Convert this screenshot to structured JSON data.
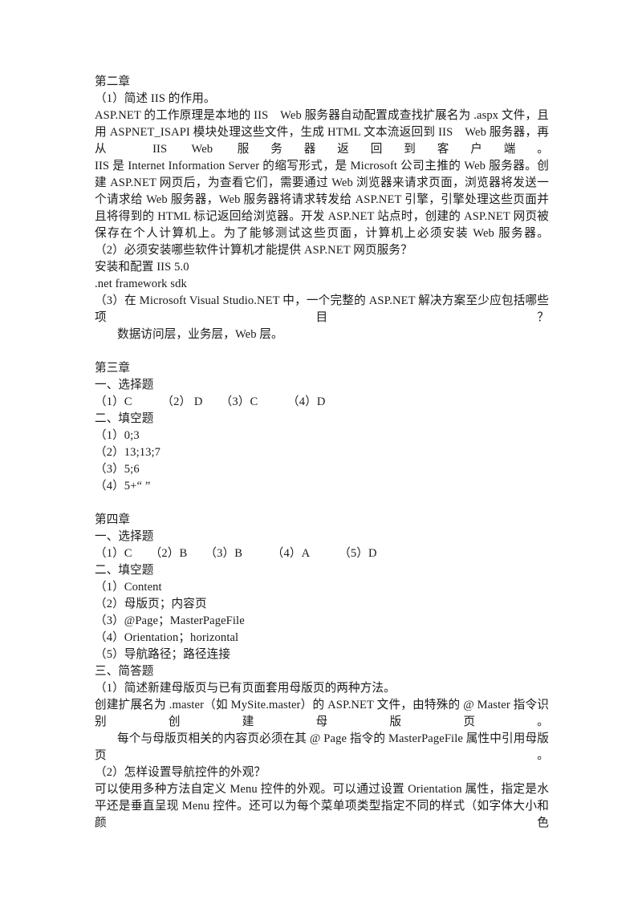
{
  "document": {
    "page_background": "#ffffff",
    "text_color": "#1a1a1a",
    "script": "Simplified Chinese with Latin technical terms"
  },
  "blocks": [
    {
      "id": "chapter2-heading",
      "name": "chapter-2-heading",
      "text": "第二章"
    },
    {
      "id": "ch2-q1",
      "name": "chapter-2-question-1",
      "text": "（1）简述 IIS 的作用。"
    },
    {
      "id": "ch2-a1-p1",
      "name": "chapter-2-answer-1-paragraph-1",
      "text": "ASP.NET 的工作原理是本地的 IIS　Web 服务器自动配置成查找扩展名为 .aspx 文件，且用 ASPNET_ISAPI 模块处理这些文件，生成 HTML 文本流返回到 IIS　Web 服务器，再从 IIS Web 服务器返回到客户端。"
    },
    {
      "id": "ch2-a1-p2",
      "name": "chapter-2-answer-1-paragraph-2",
      "text": "IIS 是 Internet Information Server 的缩写形式，是 Microsoft 公司主推的 Web 服务器。创建 ASP.NET 网页后，为查看它们，需要通过 Web 浏览器来请求页面，浏览器将发送一个请求给 Web 服务器，Web 服务器将请求转发给 ASP.NET 引擎，引擎处理这些页面并且将得到的 HTML 标记返回给浏览器。开发 ASP.NET 站点时，创建的 ASP.NET 网页被保存在个人计算机上。为了能够测试这些页面，计算机上必须安装 Web 服务器。"
    },
    {
      "id": "ch2-q2",
      "name": "chapter-2-question-2",
      "text": "（2）必须安装哪些软件计算机才能提供 ASP.NET 网页服务？"
    },
    {
      "id": "ch2-a2-l1",
      "name": "chapter-2-answer-2-line-1",
      "text": "安装和配置 IIS 5.0"
    },
    {
      "id": "ch2-a2-l2",
      "name": "chapter-2-answer-2-line-2",
      "text": ".net framework sdk"
    },
    {
      "id": "ch2-q3",
      "name": "chapter-2-question-3",
      "text": "（3）在 Microsoft Visual Studio.NET 中，一个完整的 ASP.NET 解决方案至少应包括哪些项目？"
    },
    {
      "id": "ch2-a3",
      "name": "chapter-2-answer-3",
      "text": "数据访问层，业务层，Web 层。"
    },
    {
      "id": "chapter3-heading",
      "name": "chapter-3-heading",
      "text": "第三章"
    },
    {
      "id": "ch3-sec1",
      "name": "chapter-3-section-1-heading",
      "text": "一、选择题"
    },
    {
      "id": "ch3-mcq",
      "name": "chapter-3-multiple-choice-answers",
      "text": "（1）C　　　（2） D　　（3）C　　　（4）D"
    },
    {
      "id": "ch3-sec2",
      "name": "chapter-3-section-2-heading",
      "text": "二、填空题"
    },
    {
      "id": "ch3-fill-1",
      "name": "chapter-3-fill-blank-1",
      "text": "（1）0;3"
    },
    {
      "id": "ch3-fill-2",
      "name": "chapter-3-fill-blank-2",
      "text": "（2）13;13;7"
    },
    {
      "id": "ch3-fill-3",
      "name": "chapter-3-fill-blank-3",
      "text": "（3）5;6"
    },
    {
      "id": "ch3-fill-4",
      "name": "chapter-3-fill-blank-4",
      "text": "（4）5+“ ”"
    },
    {
      "id": "chapter4-heading",
      "name": "chapter-4-heading",
      "text": "第四章"
    },
    {
      "id": "ch4-sec1",
      "name": "chapter-4-section-1-heading",
      "text": "一、选择题"
    },
    {
      "id": "ch4-mcq",
      "name": "chapter-4-multiple-choice-answers",
      "text": "（1）C　　（2）B　　（3）B　　　（4）A　　　（5）D"
    },
    {
      "id": "ch4-sec2",
      "name": "chapter-4-section-2-heading",
      "text": "二、填空题"
    },
    {
      "id": "ch4-fill-1",
      "name": "chapter-4-fill-blank-1",
      "text": "（1）Content"
    },
    {
      "id": "ch4-fill-2",
      "name": "chapter-4-fill-blank-2",
      "text": "（2）母版页；内容页"
    },
    {
      "id": "ch4-fill-3",
      "name": "chapter-4-fill-blank-3",
      "text": "（3）@Page；MasterPageFile"
    },
    {
      "id": "ch4-fill-4",
      "name": "chapter-4-fill-blank-4",
      "text": "（4）Orientation；horizontal"
    },
    {
      "id": "ch4-fill-5",
      "name": "chapter-4-fill-blank-5",
      "text": "（5）导航路径；路径连接"
    },
    {
      "id": "ch4-sec3",
      "name": "chapter-4-section-3-heading",
      "text": "三、简答题"
    },
    {
      "id": "ch4-q1",
      "name": "chapter-4-question-1",
      "text": "（1）简述新建母版页与已有页面套用母版页的两种方法。"
    },
    {
      "id": "ch4-a1-p1",
      "name": "chapter-4-answer-1-paragraph-1",
      "text": "创建扩展名为 .master（如 MySite.master）的 ASP.NET 文件，由特殊的 @ Master 指令识别创建母版页。"
    },
    {
      "id": "ch4-a1-p2",
      "name": "chapter-4-answer-1-paragraph-2",
      "text": "每个与母版页相关的内容页必须在其 @ Page 指令的 MasterPageFile 属性中引用母版页。"
    },
    {
      "id": "ch4-q2",
      "name": "chapter-4-question-2",
      "text": "（2）怎样设置导航控件的外观？"
    },
    {
      "id": "ch4-a2",
      "name": "chapter-4-answer-2-paragraph",
      "text": "可以使用多种方法自定义 Menu 控件的外观。可以通过设置 Orientation 属性，指定是水平还是垂直呈现 Menu 控件。还可以为每个菜单项类型指定不同的样式（如字体大小和颜色"
    }
  ]
}
